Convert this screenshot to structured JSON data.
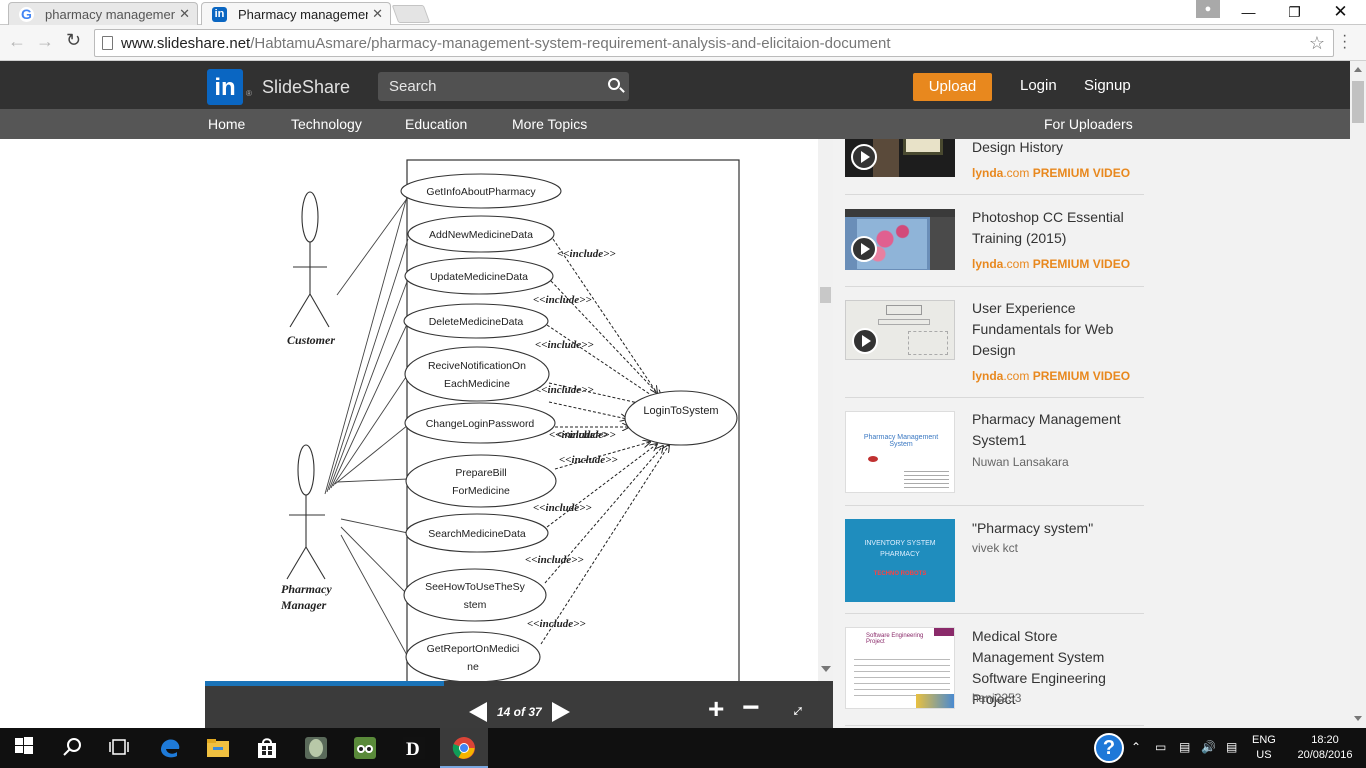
{
  "browser": {
    "tabs": [
      {
        "label": "pharmacy management sy",
        "icon": "google-icon"
      },
      {
        "label": "Pharmacy management sy",
        "icon": "linkedin-icon"
      }
    ],
    "url_host": "www.slideshare.net",
    "url_path": "/HabtamuAsmare/pharmacy-management-system-requirement-analysis-and-elicitaion-document"
  },
  "header": {
    "logo_mark": "in",
    "logo_text": "SlideShare",
    "search_placeholder": "Search",
    "upload_label": "Upload",
    "login_label": "Login",
    "signup_label": "Signup",
    "accent_color": "#e8881e"
  },
  "nav": {
    "items": [
      "Home",
      "Technology",
      "Education",
      "More Topics"
    ],
    "right_item": "For Uploaders"
  },
  "diagram": {
    "actors": [
      "Customer",
      "Pharmacy Manager"
    ],
    "use_cases": [
      [
        "GetInfoAboutPharmacy"
      ],
      [
        "AddNewMedicineData"
      ],
      [
        "UpdateMedicineData"
      ],
      [
        "DeleteMedicineData"
      ],
      [
        "ReciveNotificationOn",
        "EachMedicine"
      ],
      [
        "ChangeLoginPassword"
      ],
      [
        "PrepareBill",
        "ForMedicine"
      ],
      [
        "SearchMedicineData"
      ],
      [
        "SeeHowToUseTheSy",
        "stem"
      ],
      [
        "GetReportOnMedici",
        "ne"
      ]
    ],
    "target": "LoginToSystem",
    "include_label": "<<include>>"
  },
  "viewer": {
    "page_counter": "14 of 37",
    "current_page": 14,
    "total_pages": 37,
    "progress": 0.38
  },
  "related": [
    {
      "title": "Design History",
      "source_a": "lynda",
      "source_b": ".com",
      "source_c": "PREMIUM VIDEO"
    },
    {
      "title": "Photoshop CC Essential Training (2015)",
      "source_a": "lynda",
      "source_b": ".com",
      "source_c": "PREMIUM VIDEO"
    },
    {
      "title": "User Experience Fundamentals for Web Design",
      "source_a": "lynda",
      "source_b": ".com",
      "source_c": "PREMIUM VIDEO"
    },
    {
      "title": "Pharmacy Management System1",
      "author": "Nuwan Lansakara",
      "thumb_text": "Pharmacy Management System"
    },
    {
      "title": "\"Pharmacy system\"",
      "author": "vivek kct",
      "thumb_text": "INVENTORY SYSTEM PHARMACY",
      "thumb_text2": "TECHNO ROBOTS"
    },
    {
      "title": "Medical Store Management System Software Engineering Project",
      "author": "hani2253",
      "thumb_text": "Software Engineering Project"
    }
  ],
  "taskbar": {
    "lang_line1": "ENG",
    "lang_line2": "US",
    "time": "18:20",
    "date": "20/08/2016"
  }
}
